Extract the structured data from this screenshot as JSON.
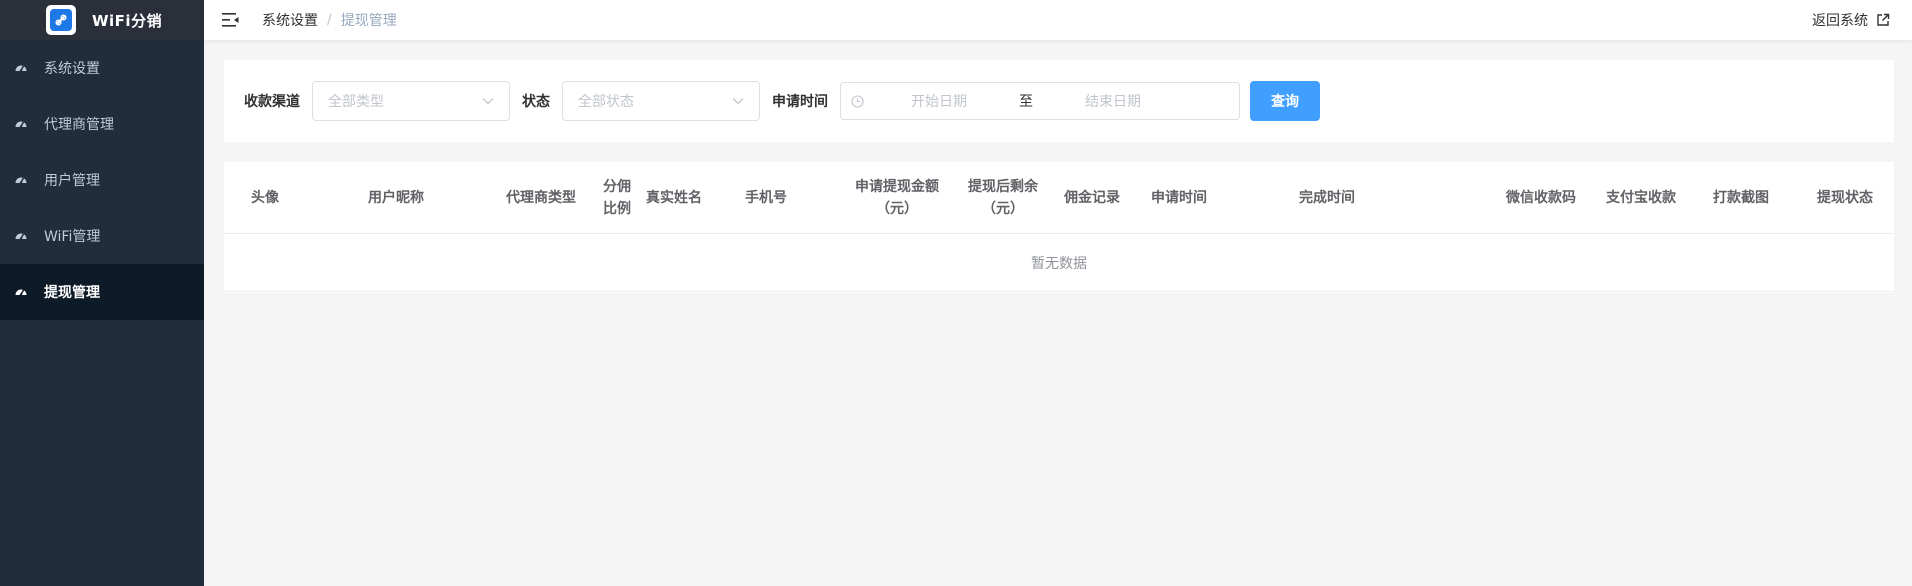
{
  "app": {
    "title": "WiFi分销"
  },
  "sidebar": {
    "items": [
      {
        "label": "系统设置",
        "active": false
      },
      {
        "label": "代理商管理",
        "active": false
      },
      {
        "label": "用户管理",
        "active": false
      },
      {
        "label": "WiFi管理",
        "active": false
      },
      {
        "label": "提现管理",
        "active": true
      }
    ]
  },
  "header": {
    "breadcrumb": [
      "系统设置",
      "提现管理"
    ],
    "separator": "/",
    "back_label": "返回系统"
  },
  "filters": {
    "channel_label": "收款渠道",
    "channel_placeholder": "全部类型",
    "status_label": "状态",
    "status_placeholder": "全部状态",
    "time_label": "申请时间",
    "start_placeholder": "开始日期",
    "range_separator": "至",
    "end_placeholder": "结束日期",
    "query_button": "查询"
  },
  "table": {
    "columns": [
      {
        "line1": "头像",
        "line2": ""
      },
      {
        "line1": "用户昵称",
        "line2": ""
      },
      {
        "line1": "代理商类型",
        "line2": ""
      },
      {
        "line1": "分佣",
        "line2": "比例"
      },
      {
        "line1": "真实姓名",
        "line2": ""
      },
      {
        "line1": "手机号",
        "line2": ""
      },
      {
        "line1": "申请提现金额",
        "line2": "（元）"
      },
      {
        "line1": "提现后剩余",
        "line2": "（元）"
      },
      {
        "line1": "佣金记录",
        "line2": ""
      },
      {
        "line1": "申请时间",
        "line2": ""
      },
      {
        "line1": "完成时间",
        "line2": ""
      },
      {
        "line1": "微信收款码",
        "line2": ""
      },
      {
        "line1": "支付宝收款",
        "line2": ""
      },
      {
        "line1": "打款截图",
        "line2": ""
      },
      {
        "line1": "提现状态",
        "line2": ""
      }
    ],
    "empty_text": "暂无数据"
  },
  "colors": {
    "sidebar_bg": "#1f2d3d",
    "sidebar_active_bg": "#0d1a28",
    "primary": "#409eff"
  }
}
